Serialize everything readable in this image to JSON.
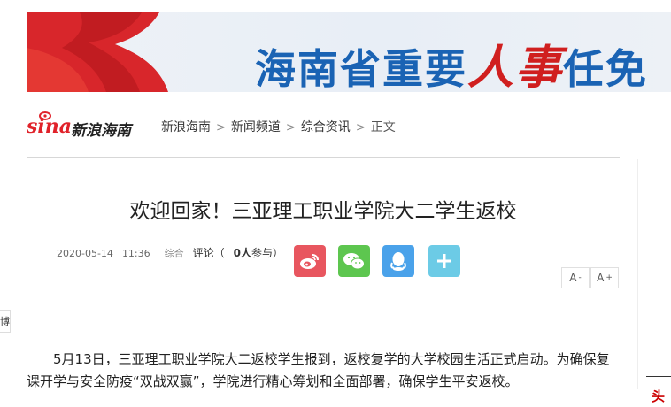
{
  "banner": {
    "title_part1": "海南省重要",
    "title_highlight": "人事",
    "title_part2": "任免"
  },
  "header": {
    "logo_brand": "sina",
    "logo_name": "新浪海南",
    "breadcrumb": [
      "新浪海南",
      "新闻频道",
      "综合资讯"
    ],
    "breadcrumb_current": "正文"
  },
  "article": {
    "title": "欢迎回家！三亚理工职业学院大二学生返校",
    "date": "2020-05-14",
    "time": "11:36",
    "category": "综合",
    "comment_label": "评论（",
    "comment_count": "0人",
    "comment_suffix": "参与）",
    "body": "5月13日，三亚理工职业学院大二返校学生报到，返校复学的大学校园生活正式启动。为确保复课开学与安全防疫“双战双赢”，学院进行精心筹划和全面部署，确保学生平安返校。"
  },
  "share": {
    "buttons": [
      "weibo-icon",
      "wechat-icon",
      "qq-icon",
      "plus-icon"
    ]
  },
  "font_controls": {
    "smaller": "A",
    "smaller_sign": "-",
    "larger": "A",
    "larger_sign": "+"
  },
  "side": {
    "tag": "博",
    "right_edge": "头"
  },
  "colors": {
    "brand_red": "#e0222a",
    "banner_blue": "#1a63b4",
    "weibo": "#e8565f",
    "wechat": "#5dc64f",
    "qq": "#4aa2ea",
    "more": "#6ccbe6"
  }
}
